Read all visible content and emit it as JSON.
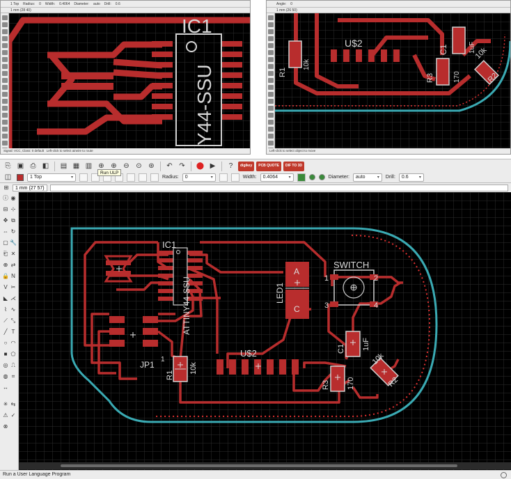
{
  "top_left_panel": {
    "toolbar_text": [
      "1 Top",
      "Radius:",
      "0",
      "Width:",
      "0.4064",
      "Diameter:",
      "auto",
      "Drill:",
      "0.6"
    ],
    "coord": "1 mm (28 40)",
    "status": "Signal: VCC, Class: 0 default",
    "status2": "Left-click to select airwire to route",
    "labels": {
      "part": "IC1",
      "value": "Y44-SSU"
    }
  },
  "top_right_panel": {
    "toolbar_text": [
      "Angle:",
      "0"
    ],
    "coord": "1 mm (26 50)",
    "status": "Left-click to select object to move",
    "labels": [
      "U$2",
      "C1",
      "1uF",
      "R1",
      "10k",
      "R3",
      "170",
      "10k",
      "R2"
    ]
  },
  "main_toolbar": {
    "tooltip": "Run ULP",
    "badges": [
      "digikey",
      "PCB QUOTE",
      "DIF TO 3D"
    ]
  },
  "param_bar": {
    "layer": "1 Top",
    "radius_label": "Radius:",
    "radius_value": "0",
    "width_label": "Width:",
    "width_value": "0.4064",
    "diameter_label": "Diameter:",
    "diameter_value": "auto",
    "drill_label": "Drill:",
    "drill_value": "0.6"
  },
  "coord_bar": {
    "coord": "1 mm (27 57)",
    "command": ""
  },
  "board": {
    "labels": {
      "ic1": "IC1",
      "ic1_value": "ATTINY44-SSU",
      "led": "LED1",
      "led_a": "A",
      "led_c": "C",
      "switch": "SWITCH",
      "pin1": "1",
      "pin2": "2",
      "pin3": "3",
      "pin4": "4",
      "u2": "U$2",
      "jp1": "JP1",
      "jp1_pin": "1",
      "r1": "R1",
      "r1_val": "10k",
      "c1": "C1",
      "c1_val": "1uF",
      "r3": "R3",
      "r3_val": "170",
      "r2": "R2",
      "r2_val": "10k"
    }
  },
  "statusbar": {
    "text": "Run a User Language Program"
  },
  "colors": {
    "copper": "#b82d2d",
    "outline": "#3aaab3",
    "dimension": "#e03030",
    "grid": "#2e2e2e"
  }
}
